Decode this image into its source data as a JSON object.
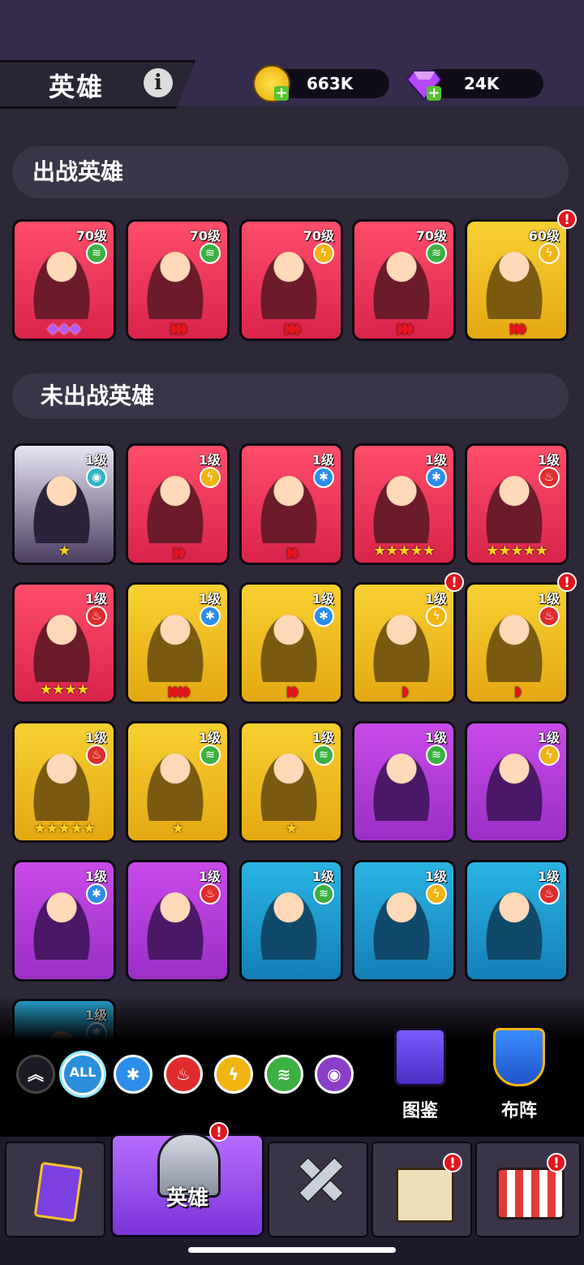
{
  "header": {
    "title": "英雄",
    "gold": "663K",
    "gems": "24K"
  },
  "sections": {
    "deployed": "出战英雄",
    "undeployed": "未出战英雄"
  },
  "deployed": [
    {
      "level": "70级",
      "element": "wind",
      "color": "red",
      "marks": "gems",
      "count": 3
    },
    {
      "level": "70级",
      "element": "wind",
      "color": "red",
      "marks": "rings",
      "count": 3
    },
    {
      "level": "70级",
      "element": "bolt",
      "color": "red",
      "marks": "rings",
      "count": 3
    },
    {
      "level": "70级",
      "element": "wind",
      "color": "red",
      "marks": "rings",
      "count": 3
    },
    {
      "level": "60级",
      "element": "bolt",
      "color": "gold",
      "marks": "rings",
      "count": 3,
      "alert": true
    }
  ],
  "undeployed": [
    {
      "level": "1级",
      "element": "eye",
      "color": "dark",
      "marks": "stars",
      "count": 1
    },
    {
      "level": "1级",
      "element": "bolt",
      "color": "red",
      "marks": "rings",
      "count": 2
    },
    {
      "level": "1级",
      "element": "ice",
      "color": "red",
      "marks": "rings",
      "count": 2
    },
    {
      "level": "1级",
      "element": "ice",
      "color": "red",
      "marks": "stars",
      "count": 5
    },
    {
      "level": "1级",
      "element": "fire",
      "color": "red",
      "marks": "stars",
      "count": 5
    },
    {
      "level": "1级",
      "element": "fire",
      "color": "red",
      "marks": "stars",
      "count": 4
    },
    {
      "level": "1级",
      "element": "ice",
      "color": "gold",
      "marks": "rings",
      "count": 4
    },
    {
      "level": "1级",
      "element": "ice",
      "color": "gold",
      "marks": "rings",
      "count": 2
    },
    {
      "level": "1级",
      "element": "bolt",
      "color": "gold",
      "marks": "rings",
      "count": 1,
      "alert": true
    },
    {
      "level": "1级",
      "element": "fire",
      "color": "gold",
      "marks": "rings",
      "count": 1,
      "alert": true
    },
    {
      "level": "1级",
      "element": "fire",
      "color": "gold",
      "marks": "stars",
      "count": 5
    },
    {
      "level": "1级",
      "element": "wind",
      "color": "gold",
      "marks": "stars",
      "count": 1
    },
    {
      "level": "1级",
      "element": "wind",
      "color": "gold",
      "marks": "stars",
      "count": 1
    },
    {
      "level": "1级",
      "element": "wind",
      "color": "purple",
      "marks": "none",
      "count": 0
    },
    {
      "level": "1级",
      "element": "bolt",
      "color": "purple",
      "marks": "none",
      "count": 0
    },
    {
      "level": "1级",
      "element": "ice",
      "color": "purple",
      "marks": "none",
      "count": 0
    },
    {
      "level": "1级",
      "element": "fire",
      "color": "purple",
      "marks": "none",
      "count": 0
    },
    {
      "level": "1级",
      "element": "wind",
      "color": "blue",
      "marks": "none",
      "count": 0
    },
    {
      "level": "1级",
      "element": "bolt",
      "color": "blue",
      "marks": "none",
      "count": 0
    },
    {
      "level": "1级",
      "element": "fire",
      "color": "blue",
      "marks": "none",
      "count": 0
    },
    {
      "level": "1级",
      "element": "ice",
      "color": "blue",
      "marks": "none",
      "count": 0
    }
  ],
  "filters": {
    "all_label": "ALL"
  },
  "side_buttons": {
    "codex": "图鉴",
    "formation": "布阵"
  },
  "nav": {
    "heroes": "英雄"
  },
  "alert_glyph": "!"
}
